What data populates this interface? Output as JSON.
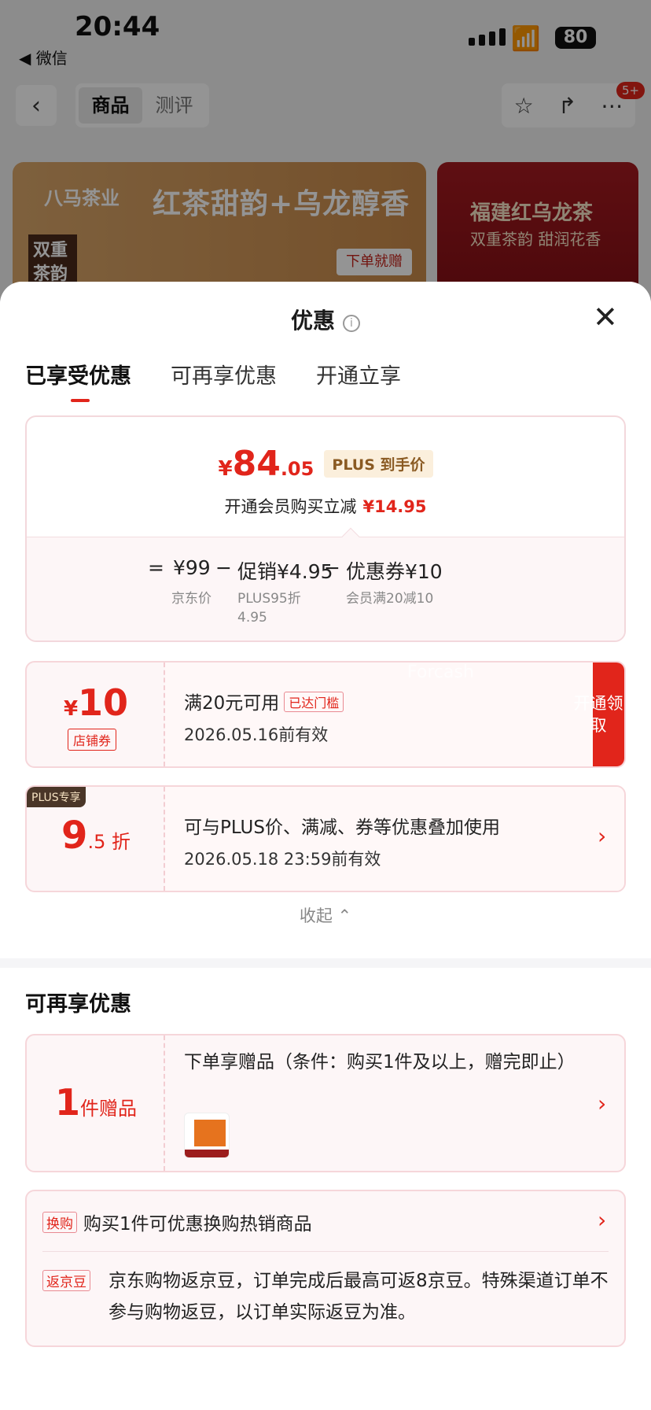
{
  "status_bar": {
    "time": "20:44",
    "back_app": "◀ 微信",
    "battery": "80"
  },
  "nav": {
    "tabs": [
      "商品",
      "测评"
    ],
    "badge": "5+"
  },
  "banner_left": {
    "brand": "八马茶业",
    "headline": "红茶甜韵+乌龙醇香",
    "side_text": "双重茶韵",
    "gift_label": "下单就赠"
  },
  "banner_right": {
    "title": "福建红乌龙茶",
    "subtitle": "双重茶韵 甜润花香"
  },
  "sheet": {
    "title": "优惠",
    "tabs": [
      "已享受优惠",
      "可再享优惠",
      "开通立享"
    ],
    "summary": {
      "currency": "¥",
      "price_int": "84",
      "price_dec": ".05",
      "plus_tag": "PLUS 到手价",
      "member_text": "开通会员购买立减",
      "member_amount": "¥14.95",
      "calc": {
        "eq": "=",
        "base": "¥99",
        "base_label": "京东价",
        "minus1": "−",
        "promo": "促销¥4.95",
        "promo_label": "PLUS95折",
        "promo_label2": "4.95",
        "minus2": "−",
        "coupon": "优惠券¥10",
        "coupon_label": "会员满20减10"
      }
    },
    "coupon1": {
      "currency": "¥",
      "amount": "10",
      "tag": "店铺券",
      "condition": "满20元可用",
      "reached": "已达门槛",
      "valid": "2026.05.16前有效",
      "claim": "开通领取",
      "watermark": "Forcash"
    },
    "coupon2": {
      "badge": "PLUS专享",
      "discount_int": "9",
      "discount_dec": ".5 折",
      "desc": "可与PLUS价、满减、券等优惠叠加使用",
      "valid": "2026.05.18 23:59前有效"
    },
    "collapse": "收起 ⌃"
  },
  "section2": {
    "title": "可再享优惠",
    "gift": {
      "num": "1",
      "unit": "件赠品",
      "text": "下单享赠品（条件：购买1件及以上，赠完即止）"
    },
    "exchange": {
      "tag": "换购",
      "text": "购买1件可优惠换购热销商品"
    },
    "jingdou": {
      "tag": "返京豆",
      "text": "京东购物返京豆，订单完成后最高可返8京豆。特殊渠道订单不参与购物返豆，以订单实际返豆为准。"
    }
  },
  "colors": {
    "accent": "#e1251b",
    "plus_badge": "#4a3628"
  }
}
